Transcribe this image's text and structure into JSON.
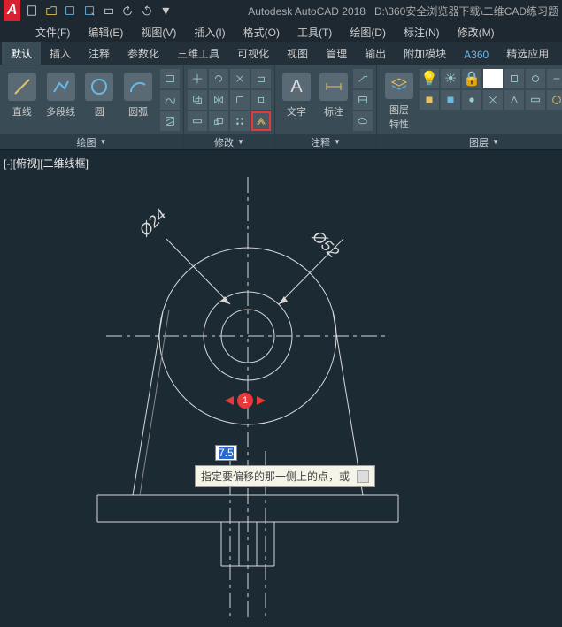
{
  "app": {
    "title": "Autodesk AutoCAD 2018",
    "file_path": "D:\\360安全浏览器下载\\二维CAD练习题"
  },
  "menus": [
    "文件(F)",
    "编辑(E)",
    "视图(V)",
    "插入(I)",
    "格式(O)",
    "工具(T)",
    "绘图(D)",
    "标注(N)",
    "修改(M)"
  ],
  "tabs": [
    "默认",
    "插入",
    "注释",
    "参数化",
    "三维工具",
    "可视化",
    "视图",
    "管理",
    "输出",
    "附加模块",
    "A360",
    "精选应用"
  ],
  "ribbon": {
    "draw": {
      "title": "绘图",
      "line": "直线",
      "polyline": "多段线",
      "circle": "圆",
      "arc": "圆弧"
    },
    "modify": {
      "title": "修改"
    },
    "annotate": {
      "title": "注释",
      "text": "文字",
      "dimension": "标注"
    },
    "layers": {
      "title": "图层",
      "props": "图层\n特性"
    }
  },
  "viewport": {
    "label": "[-][俯视][二维线框]",
    "dim1": "Ø24",
    "dim2": "Ø52",
    "input_value": "7.5",
    "tooltip": "指定要偏移的那一侧上的点，或",
    "badge": "1"
  }
}
